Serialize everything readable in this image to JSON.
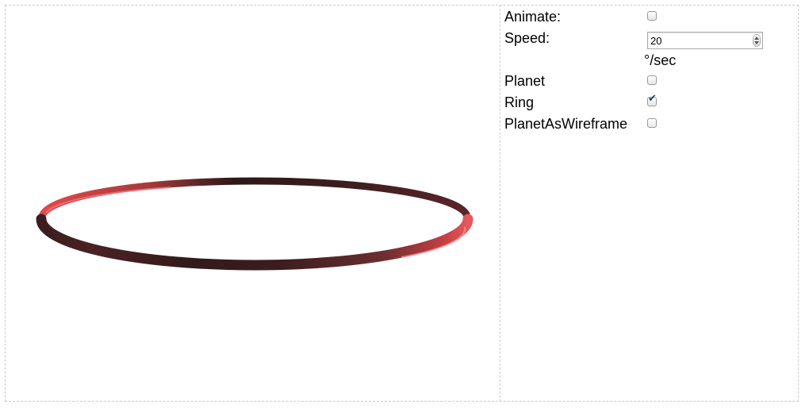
{
  "controls": {
    "animate": {
      "label": "Animate:",
      "checked": false
    },
    "speed": {
      "label": "Speed:",
      "value": "20",
      "unit": "°/sec"
    },
    "planet": {
      "label": "Planet",
      "checked": false
    },
    "ring": {
      "label": "Ring",
      "checked": true
    },
    "planet_as_wireframe": {
      "label": "PlanetAsWireframe",
      "checked": false
    }
  },
  "scene": {
    "ring_color": "#e0474b",
    "ring_shadow_color": "#3a1e1f"
  }
}
